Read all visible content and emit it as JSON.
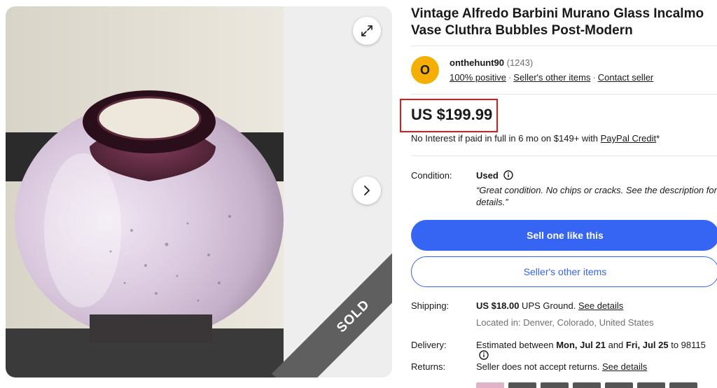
{
  "listing": {
    "title": "Vintage Alfredo Barbini Murano Glass Incalmo Vase Cluthra Bubbles Post-Modern",
    "sold_ribbon": "SOLD"
  },
  "seller": {
    "avatar_letter": "O",
    "name": "onthehunt90",
    "feedback_count": "(1243)",
    "positive": "100% positive",
    "other_items": "Seller's other items",
    "contact": "Contact seller"
  },
  "price": {
    "amount": "US $199.99",
    "financing_text": "No Interest if paid in full in 6 mo on $149+ with ",
    "paypal_link": "PayPal Credit",
    "asterisk": "*"
  },
  "condition": {
    "label": "Condition:",
    "value": "Used",
    "description": "“Great condition. No chips or cracks. See the description for details.”"
  },
  "buttons": {
    "sell_one": "Sell one like this",
    "sellers_other_items": "Seller's other items"
  },
  "shipping": {
    "label": "Shipping:",
    "cost": "US $18.00",
    "service": " UPS Ground. ",
    "details_link": "See details",
    "location": "Located in: Denver, Colorado, United States"
  },
  "delivery": {
    "label": "Delivery:",
    "prefix": "Estimated between ",
    "start": "Mon, Jul 21",
    "and": " and ",
    "end": "Fri, Jul 25",
    "suffix": " to 98115"
  },
  "returns": {
    "label": "Returns:",
    "text": "Seller does not accept returns. ",
    "details_link": "See details"
  },
  "icons": {
    "expand": "expand-icon",
    "next": "chevron-right-icon",
    "info": "info-icon"
  },
  "colors": {
    "primary_blue": "#3665f3",
    "price_highlight": "#e0191b",
    "avatar": "#f5af02"
  }
}
